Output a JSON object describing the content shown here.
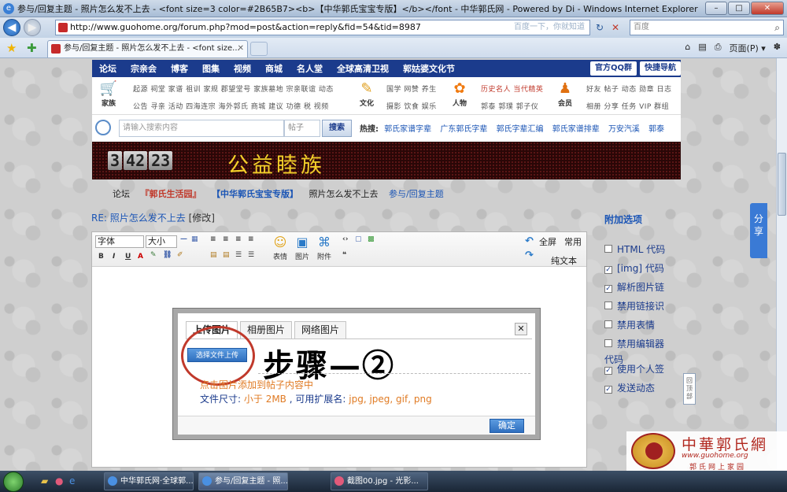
{
  "window": {
    "title": "参与/回复主题 - 照片怎么发不上去 - <font size=3 color=#2B65B7><b>【中华郭氏宝宝专版】</b></font - 中华郭氏网 - Powered by Di - Windows Internet Explorer",
    "minimize": "–",
    "maximize": "□",
    "close": "✕"
  },
  "browser": {
    "url": "http://www.guohome.org/forum.php?mod=post&action=reply&fid=54&tid=8987",
    "url_hint": "百度一下，你就知道",
    "search_placeholder": "百度",
    "tab_title": "参与/回复主题 - 照片怎么发不上去 - <font size...",
    "page_menu": "页面(P) ▾",
    "back_glyph": "◀",
    "forward_glyph": "▶",
    "refresh_glyph": "↻",
    "stop_glyph": "✕",
    "search_glyph": "⌕",
    "favorites_glyph": "★",
    "add_glyph": "✚",
    "tab_close": "✕",
    "home_glyph": "⌂",
    "feed_glyph": "▤",
    "print_glyph": "⎙",
    "tools_glyph": "✽"
  },
  "nav": {
    "items": [
      "论坛",
      "宗亲会",
      "博客",
      "图集",
      "视频",
      "商城",
      "名人堂",
      "全球高清卫视",
      "郭姑婆文化节"
    ],
    "qq_group": "官方QQ群",
    "quick_nav": "快捷导航"
  },
  "links": {
    "family": {
      "label": "家族",
      "row1": "起源 祠堂 家谱 祖训 家规 郡望堂号 家族墓地 宗亲联谊 动态",
      "row2": "公告 寻亲 活动 四海连宗 海外郭氏 商城 建议 功德 税 视频"
    },
    "culture": {
      "label": "文化",
      "row1": "国学 网赞 养生",
      "row2": "摄影 饮食 娱乐"
    },
    "people": {
      "label": "人物",
      "row1": "历史名人 当代精英",
      "row2": "郭泰 郭璞 郭子仪"
    },
    "member": {
      "label": "会员",
      "row1": "好友 帖子 动态 勋章 日志",
      "row2": "相册 分享 任务 VIP 群组"
    }
  },
  "search": {
    "placeholder": "请输入搜索内容",
    "type": "帖子",
    "button": "搜索",
    "hot_label": "热搜:",
    "hot": [
      "郭氏家谱字辈",
      "广东郭氏字辈",
      "郭氏字辈汇编",
      "郭氏家谱排辈",
      "万安汽溪",
      "郭泰"
    ]
  },
  "banner": {
    "clock": [
      "3",
      "42",
      "23"
    ],
    "title": "公益睦族"
  },
  "breadcrumb": {
    "home": "论坛",
    "forum": "『郭氏生活园』",
    "board": "【中华郭氏宝宝专版】",
    "thread": "照片怎么发不上去",
    "action": "参与/回复主题"
  },
  "reply": {
    "title": "RE: 照片怎么发不上去",
    "edit": "[修改]"
  },
  "editor": {
    "font": "字体",
    "size": "大小",
    "emoticon": "表情",
    "image": "图片",
    "attachment": "附件",
    "fullscreen": "全屏",
    "normal": "常用",
    "plaintext": "纯文本",
    "bold": "B",
    "italic": "I",
    "underline": "U",
    "color": "A",
    "quote": "❝"
  },
  "options": {
    "title": "附加选项",
    "items": [
      {
        "label": "HTML 代码",
        "checked": false
      },
      {
        "label": "[img] 代码",
        "checked": true
      },
      {
        "label": "解析图片链",
        "checked": true
      },
      {
        "label": "禁用链接识",
        "checked": false
      },
      {
        "label": "禁用表情",
        "checked": false
      },
      {
        "label": "禁用编辑器",
        "checked": false
      }
    ],
    "code_suffix": "代码",
    "items2": [
      {
        "label": "使用个人签",
        "checked": true
      },
      {
        "label": "发送动态",
        "checked": true
      }
    ],
    "share": "分享",
    "back_to_top": "回顶部"
  },
  "dialog": {
    "tabs": [
      "上传图片",
      "相册图片",
      "网络图片"
    ],
    "pick_button": "选择文件上传",
    "step_text": "步骤—②",
    "tip": "点击图片添加到帖子内容中",
    "info_label": "文件尺寸:",
    "info_size": "小于 2MB",
    "info_ext_label": ", 可用扩展名:",
    "info_ext": "jpg, jpeg, gif, png",
    "ok": "确定",
    "close": "✕"
  },
  "watermark": {
    "line1": "中華郭氏網",
    "line2": "www.guohome.org",
    "line3": "郭氏网上家园"
  },
  "taskbar": {
    "tasks": [
      "中华郭氏网·全球郭...",
      "参与/回复主题 - 照...",
      "截图00.jpg - 光影..."
    ]
  }
}
